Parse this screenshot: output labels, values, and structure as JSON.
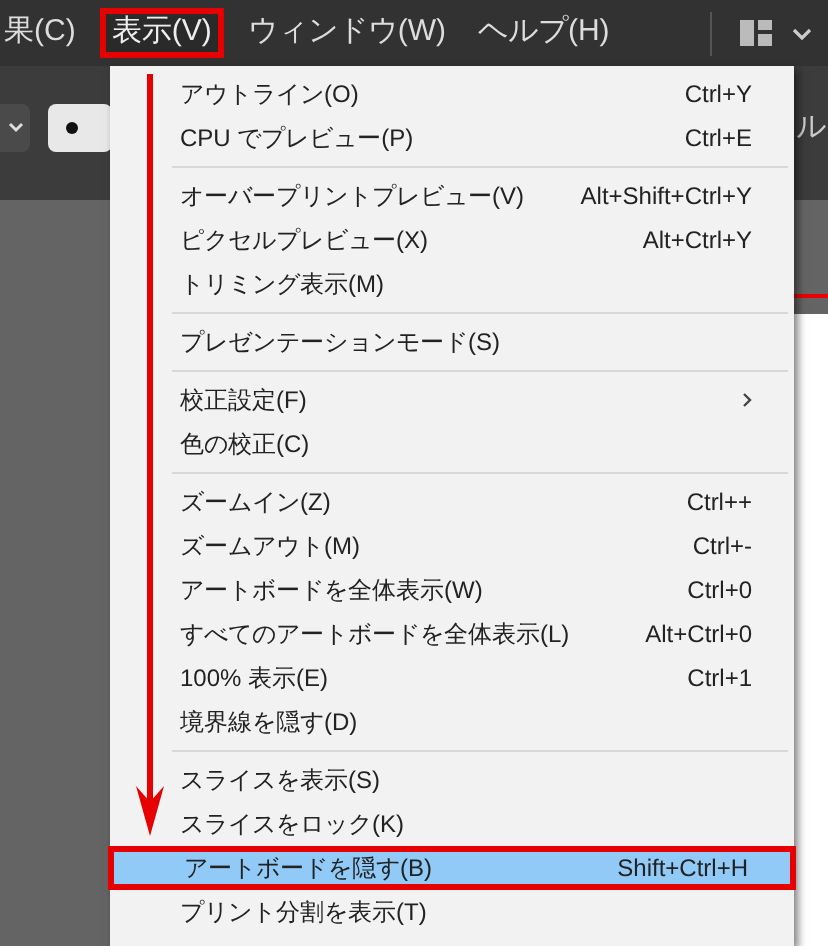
{
  "menubar": {
    "items": [
      {
        "label": "果(C)",
        "selected": false
      },
      {
        "label": "表示(V)",
        "selected": true
      },
      {
        "label": "ウィンドウ(W)",
        "selected": false
      },
      {
        "label": "ヘルプ(H)",
        "selected": false
      }
    ]
  },
  "toolbar": {
    "label": "ル"
  },
  "menu": {
    "items": [
      {
        "kind": "item",
        "label": "アウトライン(O)",
        "shortcut": "Ctrl+Y",
        "selected": false
      },
      {
        "kind": "item",
        "label": "CPU でプレビュー(P)",
        "shortcut": "Ctrl+E",
        "selected": false
      },
      {
        "kind": "separator"
      },
      {
        "kind": "item",
        "label": "オーバープリントプレビュー(V)",
        "shortcut": "Alt+Shift+Ctrl+Y",
        "selected": false
      },
      {
        "kind": "item",
        "label": "ピクセルプレビュー(X)",
        "shortcut": "Alt+Ctrl+Y",
        "selected": false
      },
      {
        "kind": "item",
        "label": "トリミング表示(M)",
        "selected": false
      },
      {
        "kind": "separator"
      },
      {
        "kind": "item",
        "label": "プレゼンテーションモード(S)",
        "selected": false
      },
      {
        "kind": "separator"
      },
      {
        "kind": "item",
        "label": "校正設定(F)",
        "submenu": true,
        "selected": false
      },
      {
        "kind": "item",
        "label": "色の校正(C)",
        "selected": false
      },
      {
        "kind": "separator"
      },
      {
        "kind": "item",
        "label": "ズームイン(Z)",
        "shortcut": "Ctrl++",
        "selected": false
      },
      {
        "kind": "item",
        "label": "ズームアウト(M)",
        "shortcut": "Ctrl+-",
        "selected": false
      },
      {
        "kind": "item",
        "label": "アートボードを全体表示(W)",
        "shortcut": "Ctrl+0",
        "selected": false
      },
      {
        "kind": "item",
        "label": "すべてのアートボードを全体表示(L)",
        "shortcut": "Alt+Ctrl+0",
        "selected": false
      },
      {
        "kind": "item",
        "label": "100% 表示(E)",
        "shortcut": "Ctrl+1",
        "selected": false
      },
      {
        "kind": "item",
        "label": "境界線を隠す(D)",
        "selected": false
      },
      {
        "kind": "separator"
      },
      {
        "kind": "item",
        "label": "スライスを表示(S)",
        "selected": false
      },
      {
        "kind": "item",
        "label": "スライスをロック(K)",
        "selected": false
      },
      {
        "kind": "item",
        "label": "アートボードを隠す(B)",
        "shortcut": "Shift+Ctrl+H",
        "selected": true
      },
      {
        "kind": "item",
        "label": "プリント分割を表示(T)",
        "selected": false
      }
    ]
  }
}
